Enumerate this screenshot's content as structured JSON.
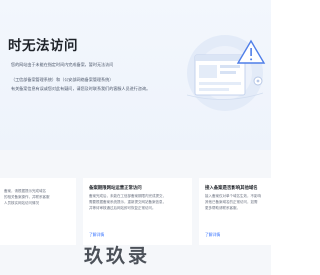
{
  "hero": {
    "title": "时无法访问",
    "desc_line1": "您的网站由于未能在指定时间内完成备案，暂时无法访问",
    "desc_line2": "（工信部备案管理系统）和（公安部网络备案管理系统）",
    "desc_line3": "有关备案信息有误或您对此有疑问，请您及时联系我们的客服人员进行咨询。"
  },
  "cards": [
    {
      "title": "",
      "lines": [
        "备案，请根据提示完成域名",
        "的相关备案操作，并联系客服",
        "人员核实网站访问情况"
      ],
      "link": ""
    },
    {
      "title": "备案期限网站运营正常访问",
      "lines": [
        "备案完成后，未能在工信部备案期限内完成提交，",
        "需要根据备案系统提示，重新提交网站备案信息，",
        "并等待审核通过后网站即可恢复正常访问。"
      ],
      "link": "了解详情"
    },
    {
      "title": "接入备案是否影响其他域名",
      "lines": [
        "接入备案仅对单个域名生效，不影响",
        "其他已备案域名的正常访问，如需",
        "更多帮助请联系客服。"
      ],
      "link": "了解详情"
    }
  ],
  "watermark": "玖玖录",
  "colors": {
    "accent": "#3370ff",
    "hero_bg": "#eef3fb",
    "page_bg": "#f5f7fa"
  }
}
